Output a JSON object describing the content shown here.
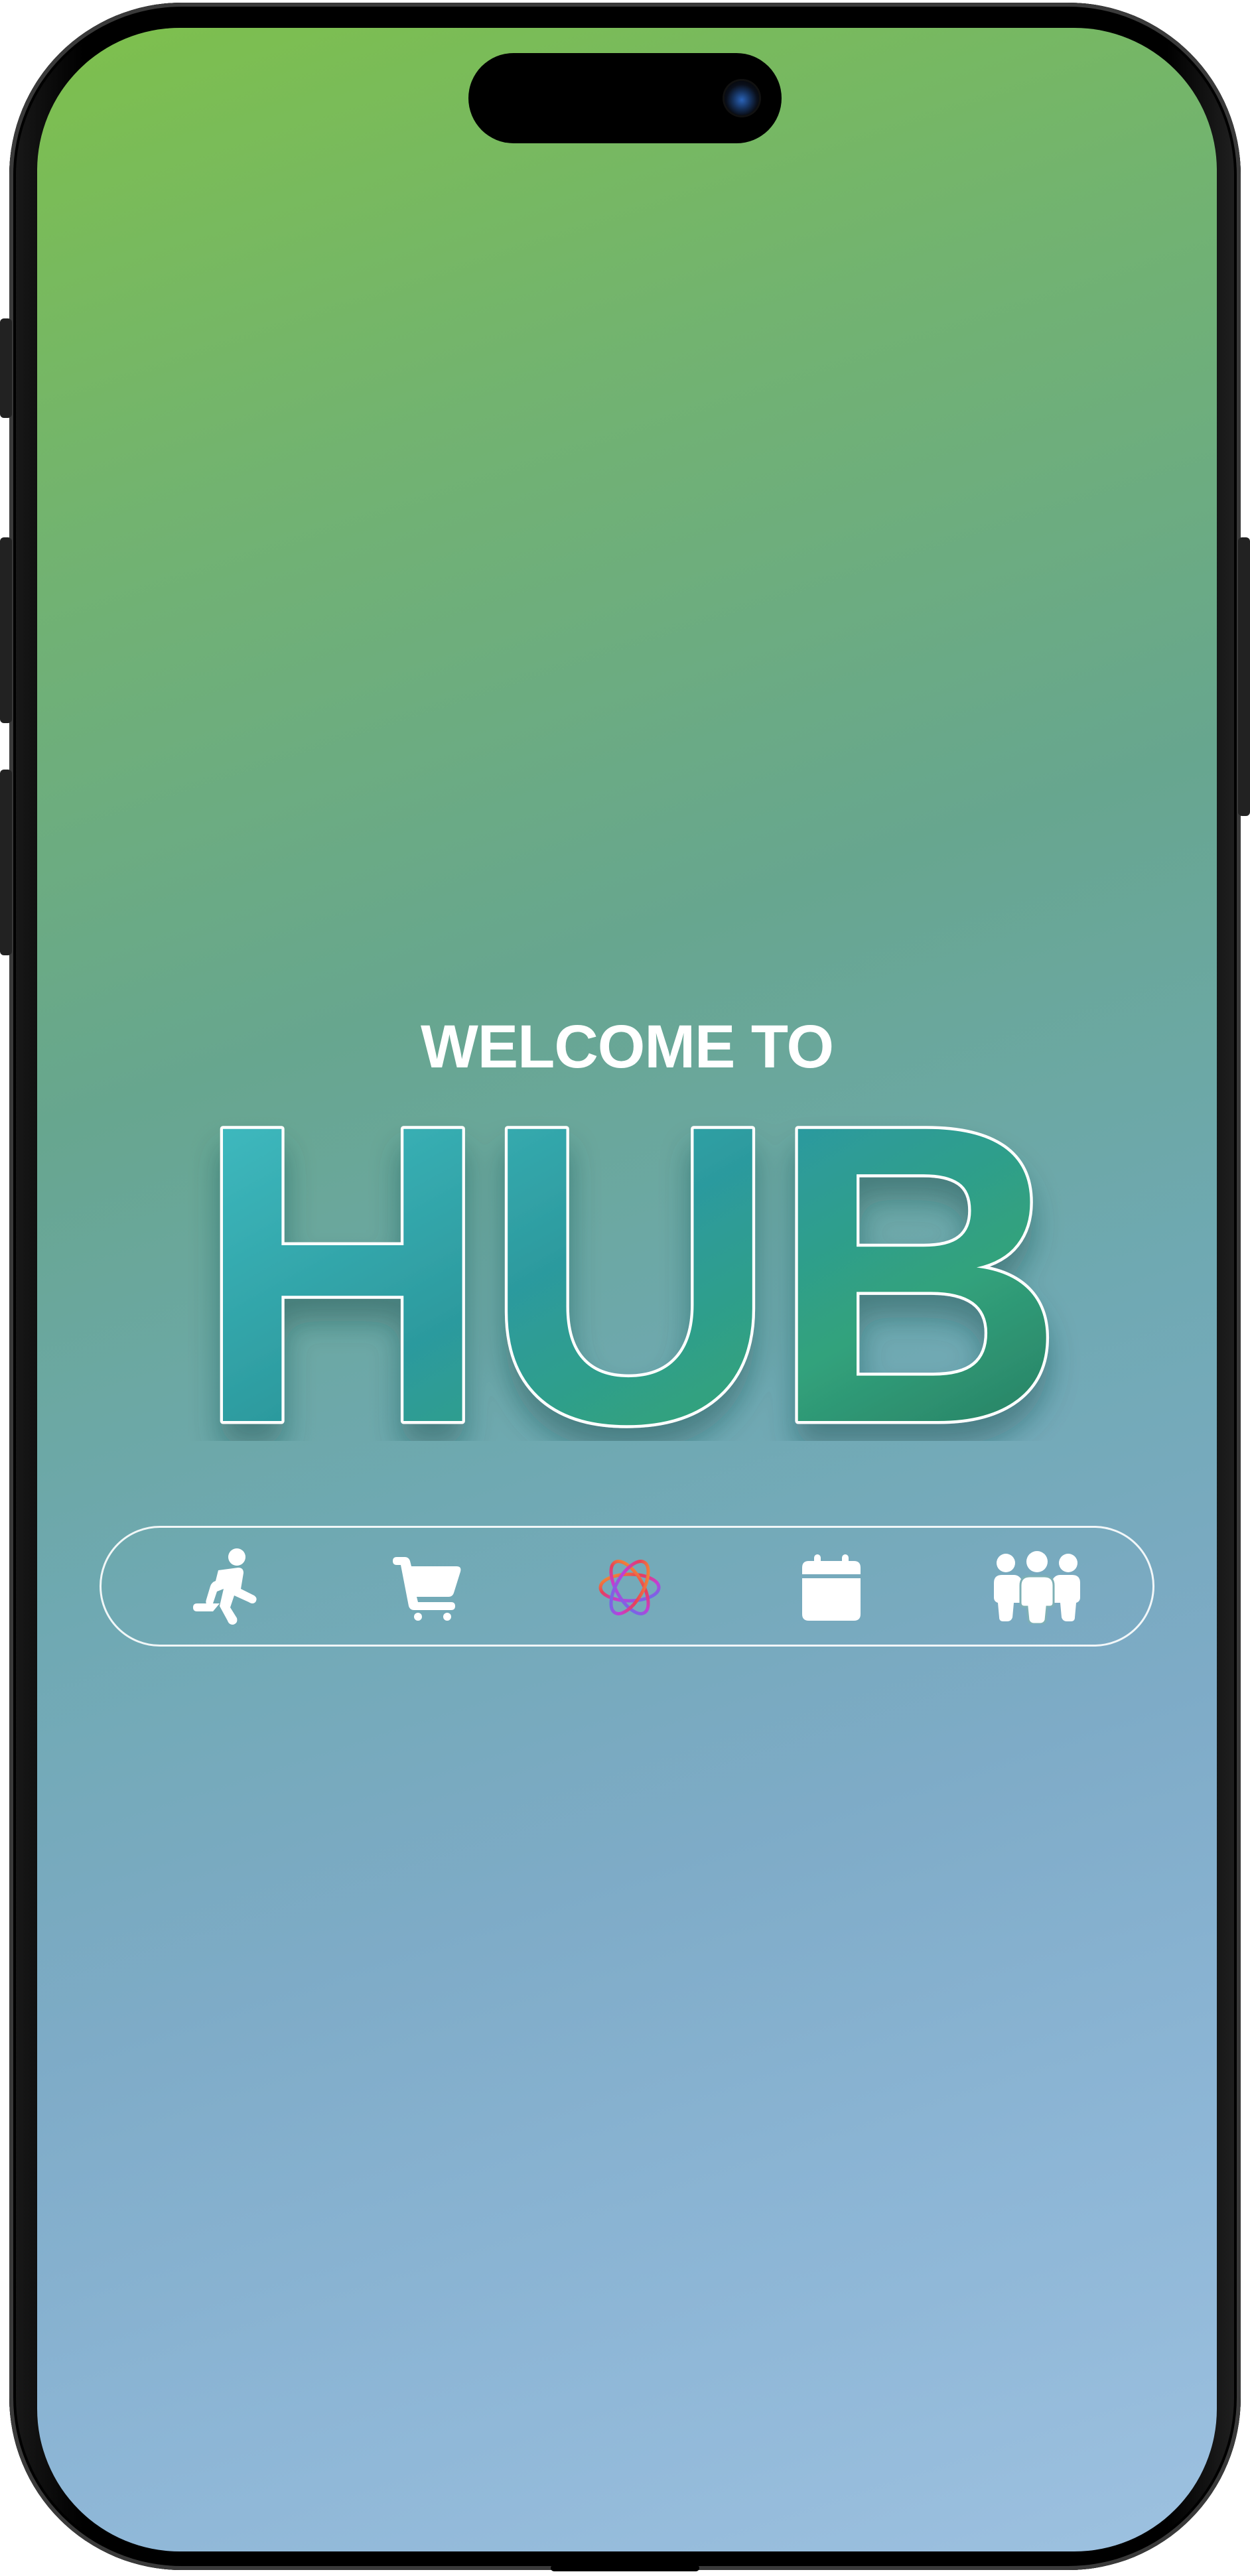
{
  "screen": {
    "welcome_text": "WELCOME TO",
    "title": "HUB"
  },
  "nav": {
    "items": [
      {
        "icon": "running-person-icon",
        "label": ""
      },
      {
        "icon": "shopping-cart-icon",
        "label": ""
      },
      {
        "icon": "flower-logo-icon",
        "label": ""
      },
      {
        "icon": "calendar-icon",
        "label": ""
      },
      {
        "icon": "people-group-icon",
        "label": ""
      }
    ]
  },
  "colors": {
    "gradient_top": "#7ec04c",
    "gradient_bottom": "#9dc1e0",
    "title_fill_start": "#3ec3c9",
    "title_fill_end": "#2a7860",
    "accent_white": "#ffffff"
  }
}
